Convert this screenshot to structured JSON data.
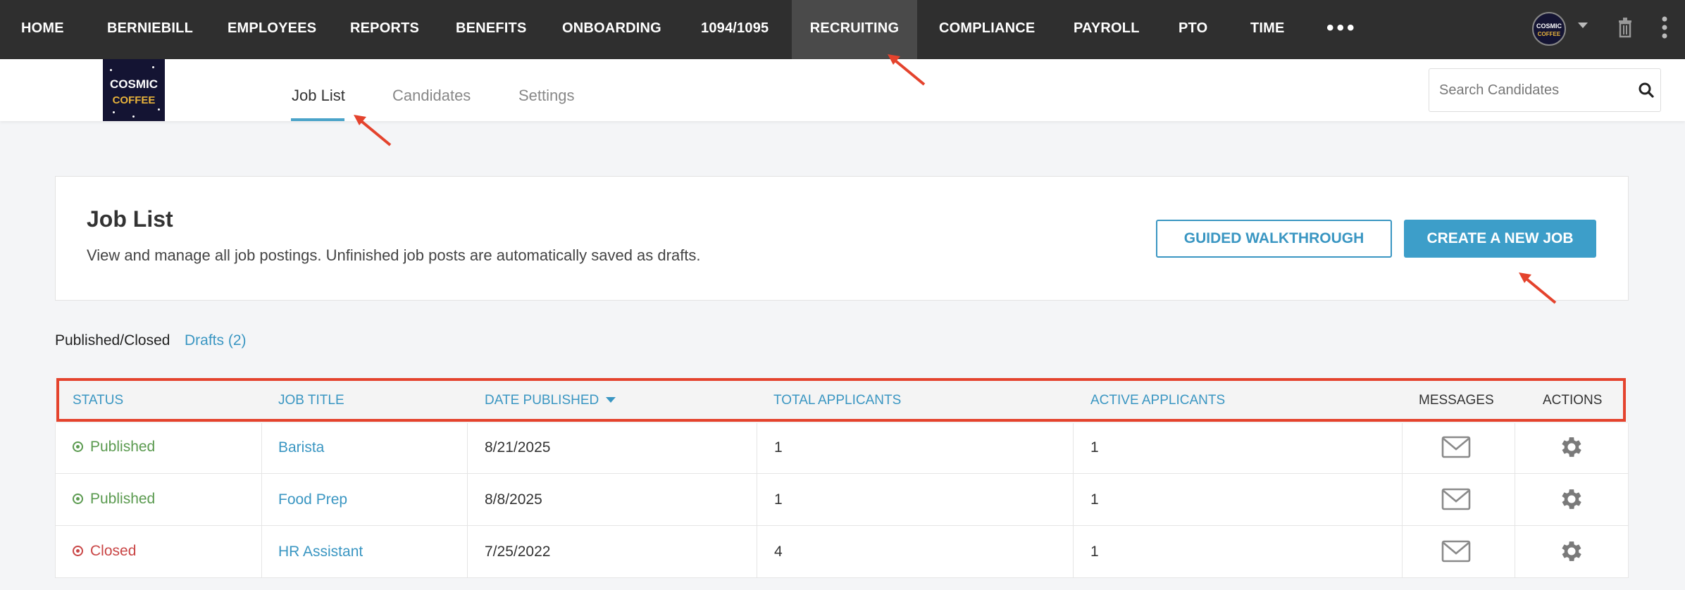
{
  "topnav": {
    "items": [
      {
        "label": "HOME",
        "active": false
      },
      {
        "label": "BERNIEBILL",
        "active": false
      },
      {
        "label": "EMPLOYEES",
        "active": false
      },
      {
        "label": "REPORTS",
        "active": false
      },
      {
        "label": "BENEFITS",
        "active": false
      },
      {
        "label": "ONBOARDING",
        "active": false
      },
      {
        "label": "1094/1095",
        "active": false
      },
      {
        "label": "RECRUITING",
        "active": true
      },
      {
        "label": "COMPLIANCE",
        "active": false
      },
      {
        "label": "PAYROLL",
        "active": false
      },
      {
        "label": "PTO",
        "active": false
      },
      {
        "label": "TIME",
        "active": false
      }
    ],
    "more_label": "•••",
    "avatar": {
      "line1": "COSMIC",
      "line2": "COFFEE"
    }
  },
  "logo": {
    "line1": "COSMIC",
    "line2": "COFFEE"
  },
  "subnav": {
    "tabs": [
      {
        "label": "Job List",
        "active": true
      },
      {
        "label": "Candidates",
        "active": false
      },
      {
        "label": "Settings",
        "active": false
      }
    ],
    "search_placeholder": "Search Candidates"
  },
  "header": {
    "title": "Job List",
    "subtitle": "View and manage all job postings. Unfinished job posts are automatically saved as drafts.",
    "walkthrough_label": "GUIDED WALKTHROUGH",
    "create_label": "CREATE A NEW JOB"
  },
  "filters": {
    "published_label": "Published/Closed",
    "drafts_label": "Drafts (2)"
  },
  "table": {
    "columns": {
      "status": "STATUS",
      "job_title": "JOB TITLE",
      "date_published": "DATE PUBLISHED",
      "total_applicants": "TOTAL APPLICANTS",
      "active_applicants": "ACTIVE APPLICANTS",
      "messages": "MESSAGES",
      "actions": "ACTIONS"
    },
    "sort_column": "date_published",
    "rows": [
      {
        "status": "Published",
        "title": "Barista",
        "date": "8/21/2025",
        "total": "1",
        "active": "1"
      },
      {
        "status": "Published",
        "title": "Food Prep",
        "date": "8/8/2025",
        "total": "1",
        "active": "1"
      },
      {
        "status": "Closed",
        "title": "HR Assistant",
        "date": "7/25/2022",
        "total": "4",
        "active": "1"
      }
    ]
  },
  "colors": {
    "accent": "#3a96c2",
    "published": "#5a9a4f",
    "closed": "#c94545",
    "annotation": "#e4432d",
    "topnav_bg": "#2f2f2f"
  }
}
